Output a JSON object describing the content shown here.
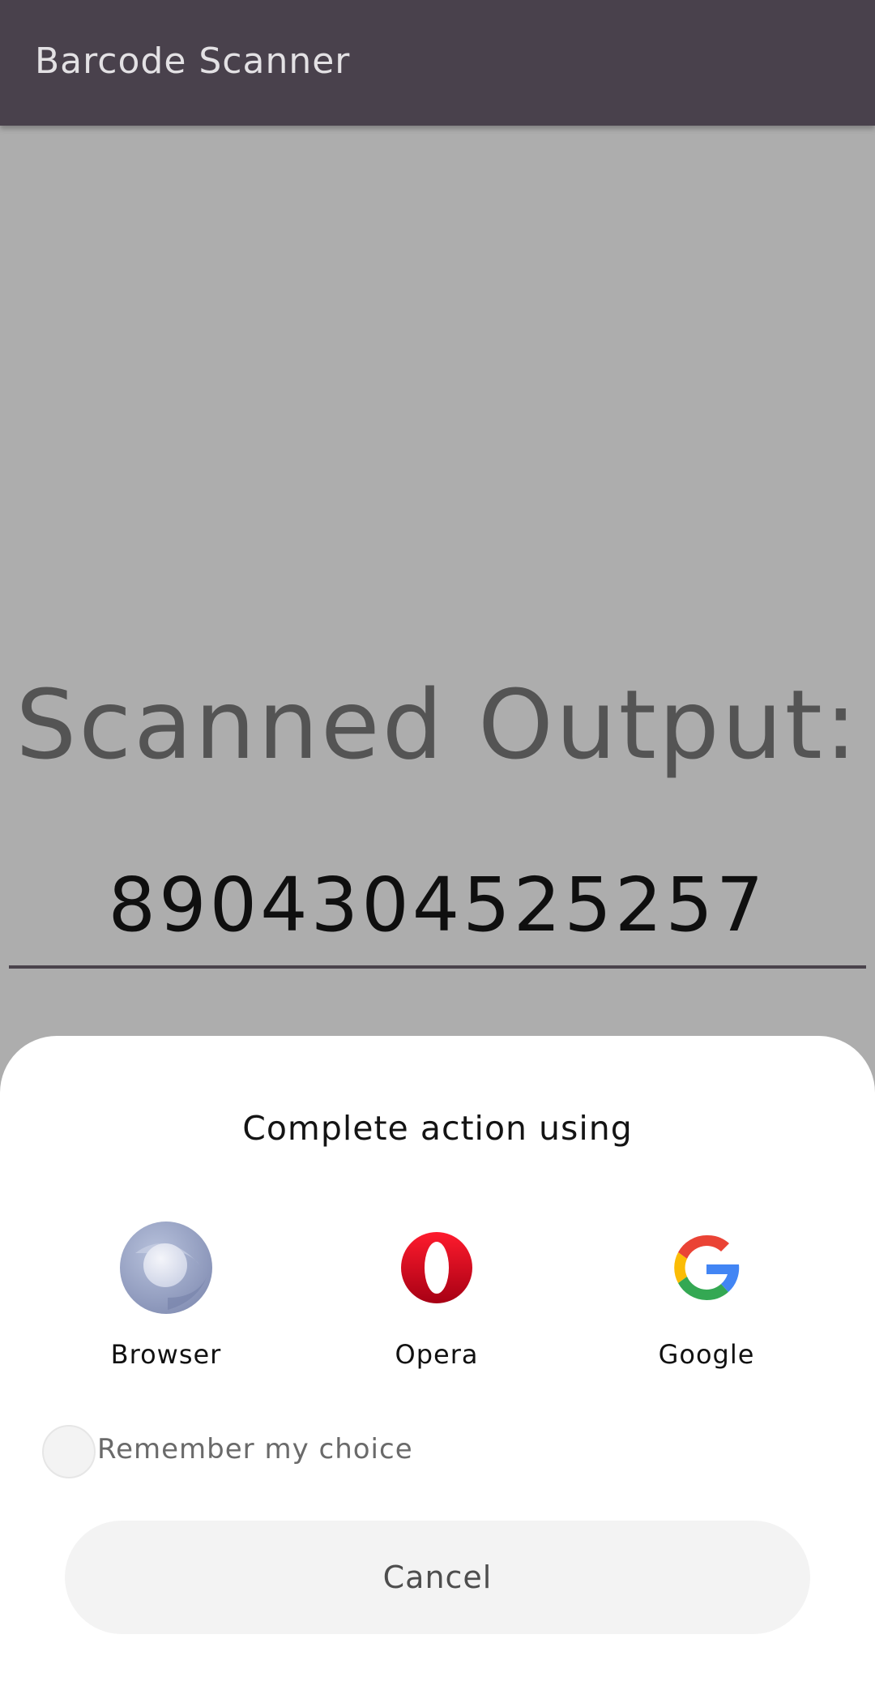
{
  "app_bar": {
    "title": "Barcode Scanner"
  },
  "main": {
    "heading": "Scanned Output:",
    "scanned_value": "8904304525257"
  },
  "chooser": {
    "title": "Complete action using",
    "apps": [
      {
        "label": "Browser",
        "icon": "browser-icon"
      },
      {
        "label": "Opera",
        "icon": "opera-icon"
      },
      {
        "label": "Google",
        "icon": "google-icon"
      }
    ],
    "remember_label": "Remember my choice",
    "cancel_label": "Cancel"
  },
  "colors": {
    "app_bar": "#49414c",
    "scrim_background": "#adadad",
    "sheet": "#ffffff"
  }
}
